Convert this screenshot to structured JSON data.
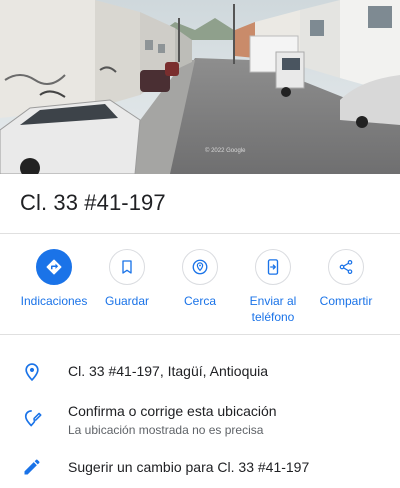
{
  "place": {
    "title": "Cl. 33 #41-197"
  },
  "streetview": {
    "watermark": "© 2022 Google"
  },
  "actions": [
    {
      "label": "Indicaciones",
      "icon": "directions-icon"
    },
    {
      "label": "Guardar",
      "icon": "bookmark-icon"
    },
    {
      "label": "Cerca",
      "icon": "nearby-icon"
    },
    {
      "label": "Enviar al teléfono",
      "icon": "send-to-phone-icon"
    },
    {
      "label": "Compartir",
      "icon": "share-icon"
    }
  ],
  "info": {
    "address": "Cl. 33 #41-197, Itagüí, Antioquia",
    "confirm_title": "Confirma o corrige esta ubicación",
    "confirm_sub": "La ubicación mostrada no es precisa",
    "suggest": "Sugerir un cambio para Cl. 33 #41-197"
  },
  "colors": {
    "accent": "#1a73e8",
    "text": "#202124",
    "secondary_text": "#5f6368",
    "divider": "#e0e0e0"
  }
}
